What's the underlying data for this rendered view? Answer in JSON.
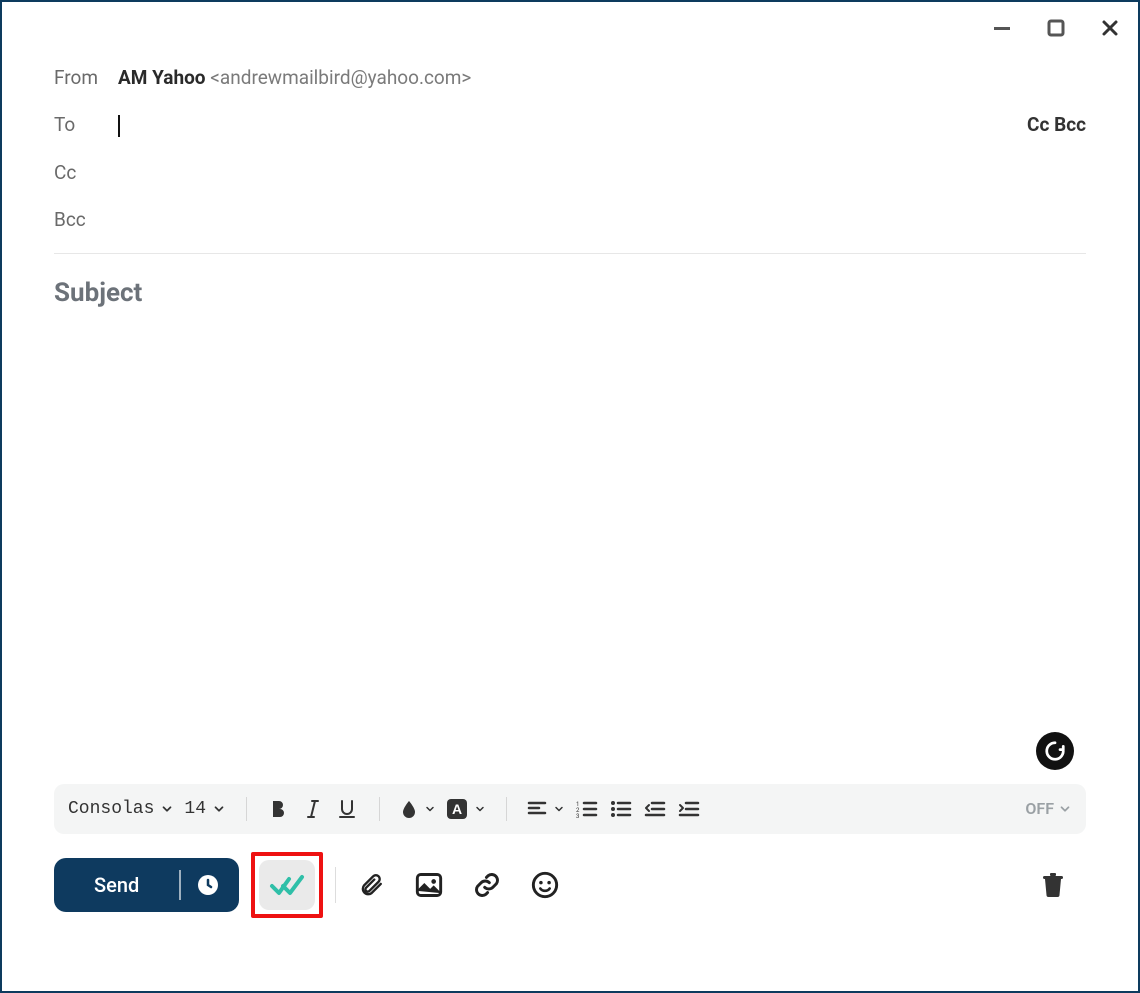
{
  "titlebar": {
    "minimize": "minimize",
    "maximize": "maximize",
    "close": "close"
  },
  "header": {
    "from_label": "From",
    "from_name": "AM Yahoo",
    "from_email": "<andrewmailbird@yahoo.com>",
    "to_label": "To",
    "cc_label": "Cc",
    "bcc_label": "Bcc",
    "ccbcc_toggle": "Cc Bcc"
  },
  "subject": {
    "placeholder": "Subject"
  },
  "format": {
    "font": "Consolas",
    "size": "14",
    "off": "OFF"
  },
  "send": {
    "label": "Send"
  }
}
